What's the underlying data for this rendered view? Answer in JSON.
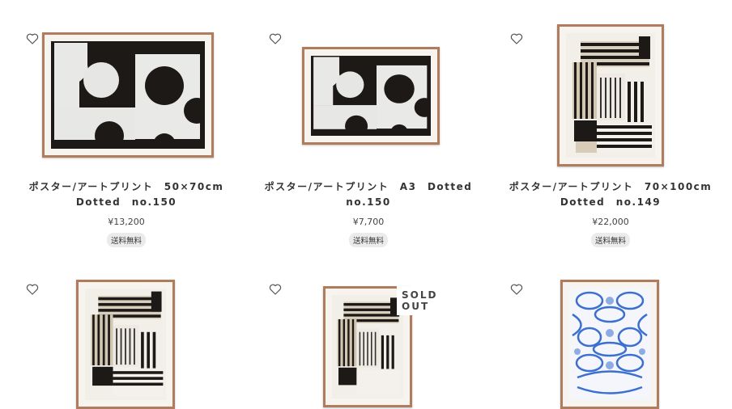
{
  "products": [
    {
      "title_line1": "ポスター/アートプリント　50×70cm",
      "title_line2": "Dotted　no.150",
      "price": "¥13,200",
      "badge": "送料無料",
      "favorite_icon": "heart-outline-icon",
      "artwork": "dotted-black-white"
    },
    {
      "title_line1": "ポスター/アートプリント　A3　Dotted",
      "title_line2": "no.150",
      "price": "¥7,700",
      "badge": "送料無料",
      "favorite_icon": "heart-outline-icon",
      "artwork": "dotted-black-white"
    },
    {
      "title_line1": "ポスター/アートプリント　70×100cm",
      "title_line2": "Dotted　no.149",
      "price": "¥22,000",
      "badge": "送料無料",
      "favorite_icon": "heart-outline-icon",
      "artwork": "striped-collage"
    },
    {
      "favorite_icon": "heart-outline-icon",
      "artwork": "striped-collage"
    },
    {
      "favorite_icon": "heart-outline-icon",
      "artwork": "striped-collage",
      "status": "SOLD OUT"
    },
    {
      "favorite_icon": "heart-outline-icon",
      "artwork": "blue-pattern"
    }
  ],
  "colors": {
    "frame": "#b07c5e",
    "badge_bg": "#ebebeb",
    "text": "#333333",
    "art_black": "#1c1917",
    "art_blue": "#3b6fd1"
  }
}
